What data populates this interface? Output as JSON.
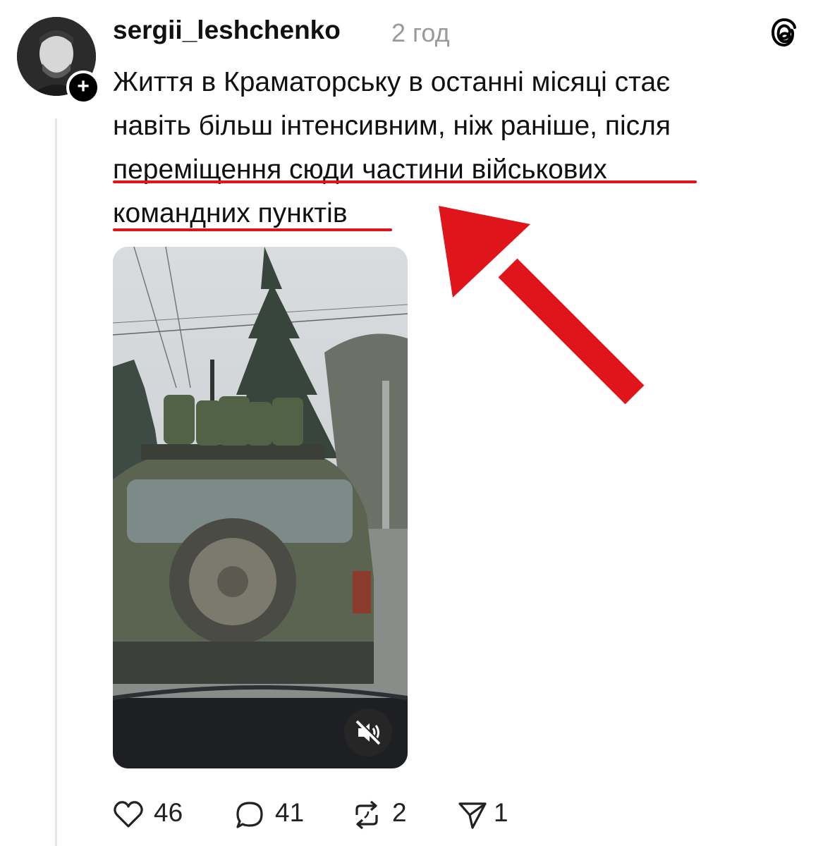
{
  "post": {
    "username": "sergii_leshchenko",
    "timestamp": "2 год",
    "follow_icon": "plus",
    "text_line1": "Життя в Краматорську в останні місяці стає",
    "text_line2": "навіть більш інтенсивним, ніж раніше, після",
    "text_line3": "переміщення сюди частини військових",
    "text_line4": "командних пунктів"
  },
  "actions": {
    "likes": "46",
    "replies": "41",
    "reposts": "2",
    "shares": "1"
  },
  "icons": {
    "brand": "threads-icon",
    "like": "heart-icon",
    "reply": "comment-icon",
    "repost": "repost-icon",
    "share": "send-icon",
    "mute": "muted-speaker-icon"
  },
  "colors": {
    "annotation": "#e0141b",
    "timestamp": "#9a9a9a"
  }
}
